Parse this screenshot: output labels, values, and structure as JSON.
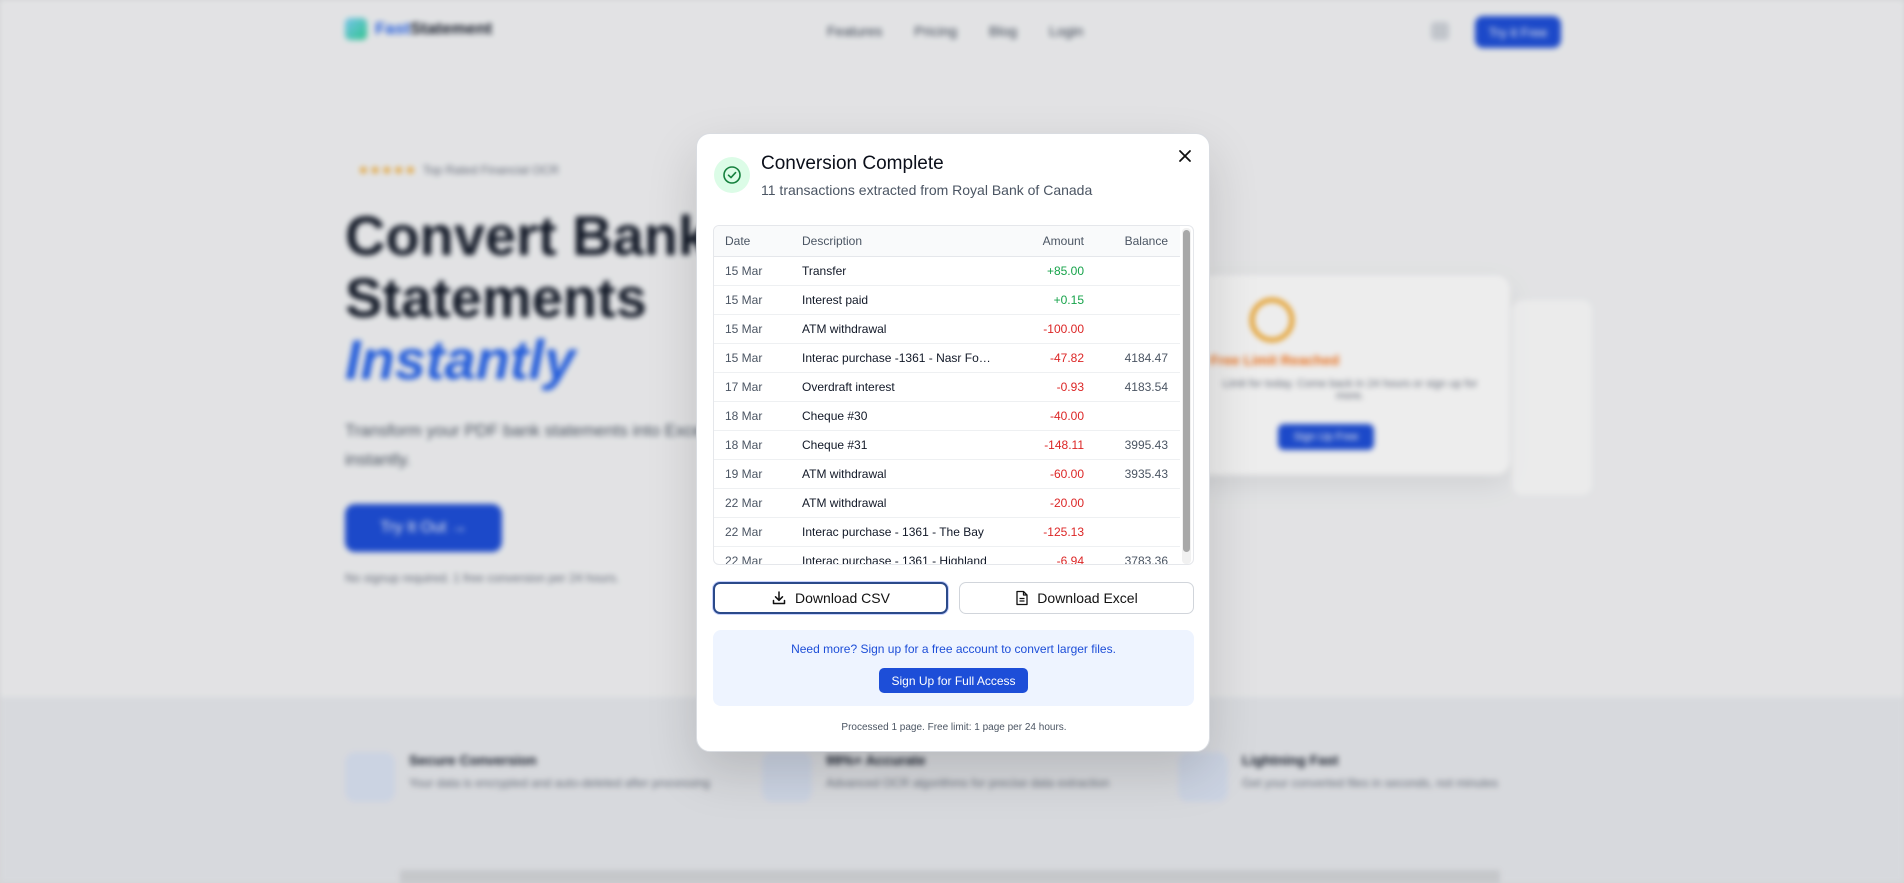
{
  "background": {
    "nav": {
      "brand_accent": "Fast",
      "brand_rest": "Statement",
      "links": [
        "Features",
        "Pricing",
        "Blog",
        "Login"
      ],
      "cta": "Try it Free"
    },
    "hero": {
      "badge": "Top Rated Financial OCR",
      "title_line1": "Convert Bank",
      "title_line2": "Statements",
      "title_line3": "Instantly",
      "subtitle": "Transform your PDF bank statements into Excel instantly.",
      "button": "Try It Out →",
      "note": "No signup required. 1 free conversion per 24 hours."
    },
    "preview": {
      "warning": "Free Limit Reached",
      "text": "Limit for today. Come back in 24 hours or sign up for more.",
      "button": "Sign Up Free"
    },
    "features": [
      {
        "title": "Secure Conversion",
        "text": "Your data is encrypted and auto-deleted after processing"
      },
      {
        "title": "99%+ Accurate",
        "text": "Advanced OCR algorithms for precise data extraction"
      },
      {
        "title": "Lightning Fast",
        "text": "Get your converted files in seconds, not minutes"
      }
    ]
  },
  "modal": {
    "title": "Conversion Complete",
    "subtitle": "11 transactions extracted from Royal Bank of Canada",
    "columns": {
      "date": "Date",
      "description": "Description",
      "amount": "Amount",
      "balance": "Balance"
    },
    "transactions": [
      {
        "date": "15 Mar",
        "description": "Transfer",
        "amount": "+85.00",
        "balance": ""
      },
      {
        "date": "15 Mar",
        "description": "Interest paid",
        "amount": "+0.15",
        "balance": ""
      },
      {
        "date": "15 Mar",
        "description": "ATM withdrawal",
        "amount": "-100.00",
        "balance": ""
      },
      {
        "date": "15 Mar",
        "description": "Interac purchase -1361 - Nasr Foo...",
        "amount": "-47.82",
        "balance": "4184.47"
      },
      {
        "date": "17 Mar",
        "description": "Overdraft interest",
        "amount": "-0.93",
        "balance": "4183.54"
      },
      {
        "date": "18 Mar",
        "description": "Cheque #30",
        "amount": "-40.00",
        "balance": ""
      },
      {
        "date": "18 Mar",
        "description": "Cheque #31",
        "amount": "-148.11",
        "balance": "3995.43"
      },
      {
        "date": "19 Mar",
        "description": "ATM withdrawal",
        "amount": "-60.00",
        "balance": "3935.43"
      },
      {
        "date": "22 Mar",
        "description": "ATM withdrawal",
        "amount": "-20.00",
        "balance": ""
      },
      {
        "date": "22 Mar",
        "description": "Interac purchase - 1361 - The Bay",
        "amount": "-125.13",
        "balance": ""
      },
      {
        "date": "22 Mar",
        "description": "Interac purchase - 1361 - Highland",
        "amount": "-6.94",
        "balance": "3783.36"
      }
    ],
    "download_csv": "Download CSV",
    "download_excel": "Download Excel",
    "promo_text": "Need more? Sign up for a free account to convert larger files.",
    "promo_button": "Sign Up for Full Access",
    "footnote": "Processed 1 page. Free limit: 1 page per 24 hours.",
    "colors": {
      "positive": "#16a34a",
      "negative": "#dc2626",
      "accent": "#1d4ed8"
    }
  }
}
